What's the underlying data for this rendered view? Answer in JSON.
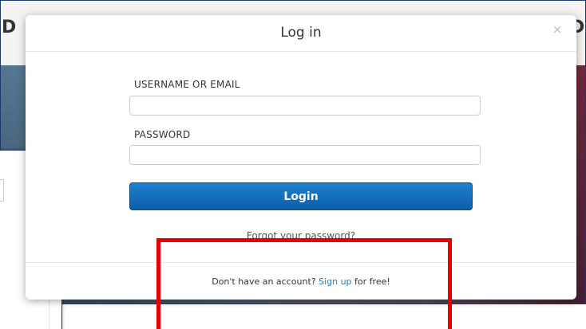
{
  "modal": {
    "title": "Log in",
    "close_glyph": "×",
    "username_label": "USERNAME OR EMAIL",
    "username_value": "",
    "password_label": "PASSWORD",
    "password_value": "",
    "login_button": "Login",
    "forgot_password_link": "Forgot your password?",
    "footer": {
      "prefix": "Don't have an account? ",
      "signup_link": "Sign up",
      "suffix": " for free!"
    }
  },
  "background": {
    "left_edge_text": "D",
    "right_edge_text": "D,"
  },
  "colors": {
    "login_button": "#0d5fa8",
    "link": "#2a7ab8",
    "highlight": "#e60000"
  },
  "icons": {
    "close": "close-icon"
  }
}
